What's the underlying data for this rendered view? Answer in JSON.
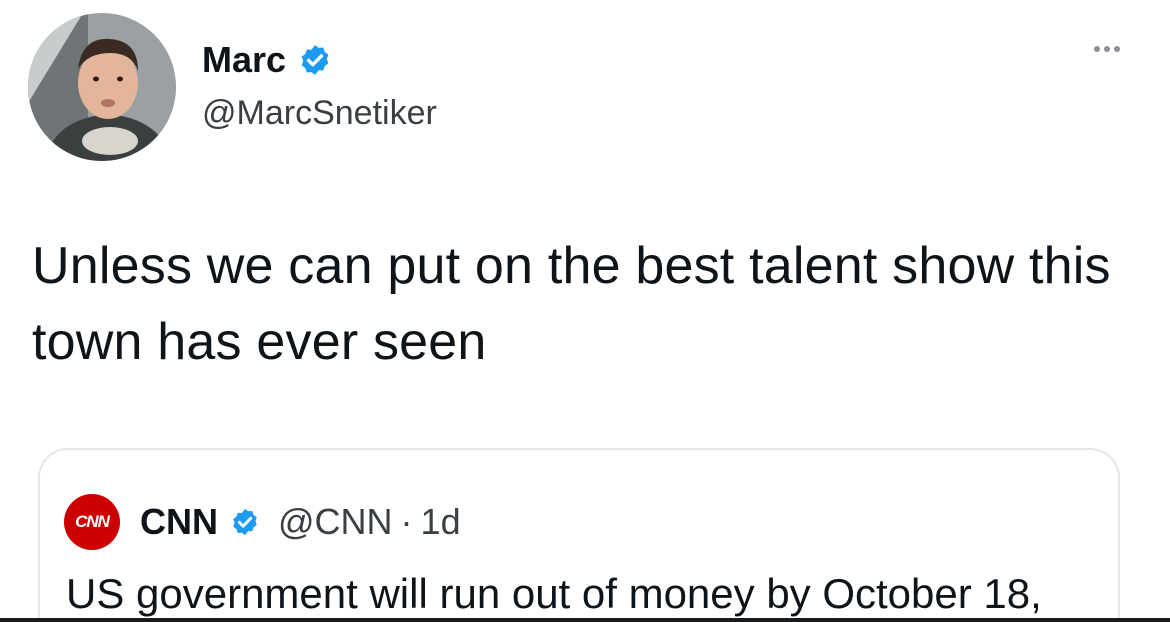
{
  "tweet": {
    "author": {
      "name": "Marc",
      "handle": "@MarcSnetiker",
      "verified": true
    },
    "text": "Unless we can put on the best talent show this town has ever seen",
    "quoted_tweet": {
      "author_name": "CNN",
      "author_handle": "@CNN",
      "separator": "·",
      "time_ago": "1d",
      "logo_text": "CNN",
      "verified": true,
      "text": "US government will run out of money by October 18,"
    }
  },
  "icons": {
    "avatar": "avatar-photo",
    "verified": "verified-badge-icon",
    "more": "more-options-icon",
    "quote_logo": "cnn-logo-icon"
  },
  "colors": {
    "verified_blue": "#1d9bf0",
    "cnn_red": "#cc0000",
    "text_primary": "#0f1419",
    "text_secondary": "#3a3f44",
    "card_border": "#e3e7ea"
  }
}
